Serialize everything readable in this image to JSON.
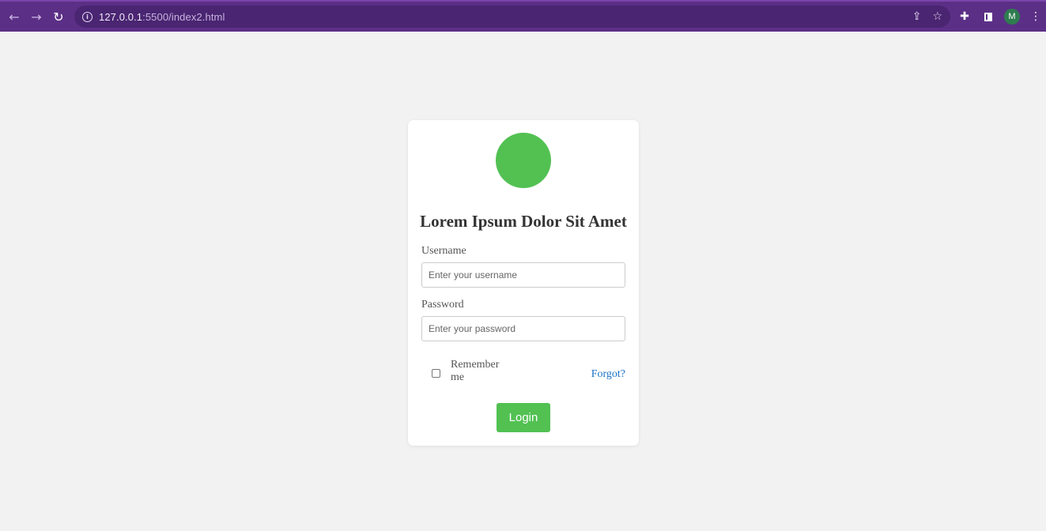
{
  "browser": {
    "url_host": "127.0.0.1",
    "url_path": ":5500/index2.html",
    "profile_initial": "M",
    "icons": {
      "back": "arrow-left-icon",
      "forward": "arrow-right-icon",
      "reload": "reload-icon",
      "site_info": "info-icon",
      "share": "share-icon",
      "bookmark": "star-icon",
      "extensions": "puzzle-icon",
      "side_panel": "side-panel-icon",
      "menu": "kebab-menu-icon"
    },
    "colors": {
      "toolbar": "#5b2f86",
      "omnibox": "#4a2572"
    }
  },
  "login": {
    "title": "Lorem Ipsum Dolor Sit Amet",
    "username_label": "Username",
    "username_placeholder": "Enter your username",
    "username_value": "",
    "password_label": "Password",
    "password_placeholder": "Enter your password",
    "password_value": "",
    "remember_label": "Remember me",
    "remember_checked": false,
    "forgot_label": "Forgot?",
    "login_button_label": "Login",
    "colors": {
      "accent": "#52c152",
      "link": "#1a73c8",
      "background": "#f2f2f2",
      "card": "#ffffff"
    }
  }
}
